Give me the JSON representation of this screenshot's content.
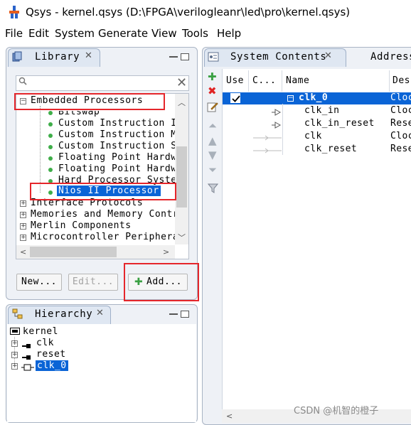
{
  "window": {
    "title": "Qsys - kernel.qsys (D:\\FPGA\\verilogleanr\\led\\pro\\kernel.qsys)"
  },
  "menu": [
    "File",
    "Edit",
    "System",
    "Generate",
    "View",
    "Tools",
    "Help"
  ],
  "library": {
    "tab_label": "Library",
    "search": {
      "value": "",
      "placeholder": ""
    },
    "tree": [
      {
        "label": "Embedded Processors",
        "expander": "−"
      },
      {
        "label": "Bitswap"
      },
      {
        "label": "Custom Instruction I"
      },
      {
        "label": "Custom Instruction M"
      },
      {
        "label": "Custom Instruction S"
      },
      {
        "label": "Floating Point Hardw"
      },
      {
        "label": "Floating Point Hardw"
      },
      {
        "label": "Hard Processor Syste"
      },
      {
        "label": "Nios II Processor"
      },
      {
        "label": "Interface Protocols",
        "expander": "+"
      },
      {
        "label": "Memories and Memory Contr",
        "expander": "+"
      },
      {
        "label": "Merlin Components",
        "expander": "+"
      },
      {
        "label": "Microcontroller Periphera",
        "expander": "+"
      }
    ],
    "buttons": {
      "new": "New...",
      "edit": "Edit...",
      "add": "Add..."
    }
  },
  "hierarchy": {
    "tab_label": "Hierarchy",
    "root": "kernel",
    "items": [
      "clk",
      "reset",
      "clk_0"
    ]
  },
  "system_contents": {
    "tab_label": "System Contents",
    "second_tab_label": "Address",
    "columns": [
      "Use",
      "C...",
      "Name",
      "Des"
    ],
    "rows": [
      {
        "name": "clk_0",
        "desc": "Cloc",
        "selected": true
      },
      {
        "name": "clk_in",
        "desc": "Cloc"
      },
      {
        "name": "clk_in_reset",
        "desc": "Rese"
      },
      {
        "name": "clk",
        "desc": "Cloc"
      },
      {
        "name": "clk_reset",
        "desc": "Rese"
      }
    ]
  },
  "watermark": "CSDN @机智的橙子",
  "colors": {
    "selection": "#0a64d6",
    "highlight_box": "#e5262b",
    "panel_bg": "#eef1f6"
  }
}
